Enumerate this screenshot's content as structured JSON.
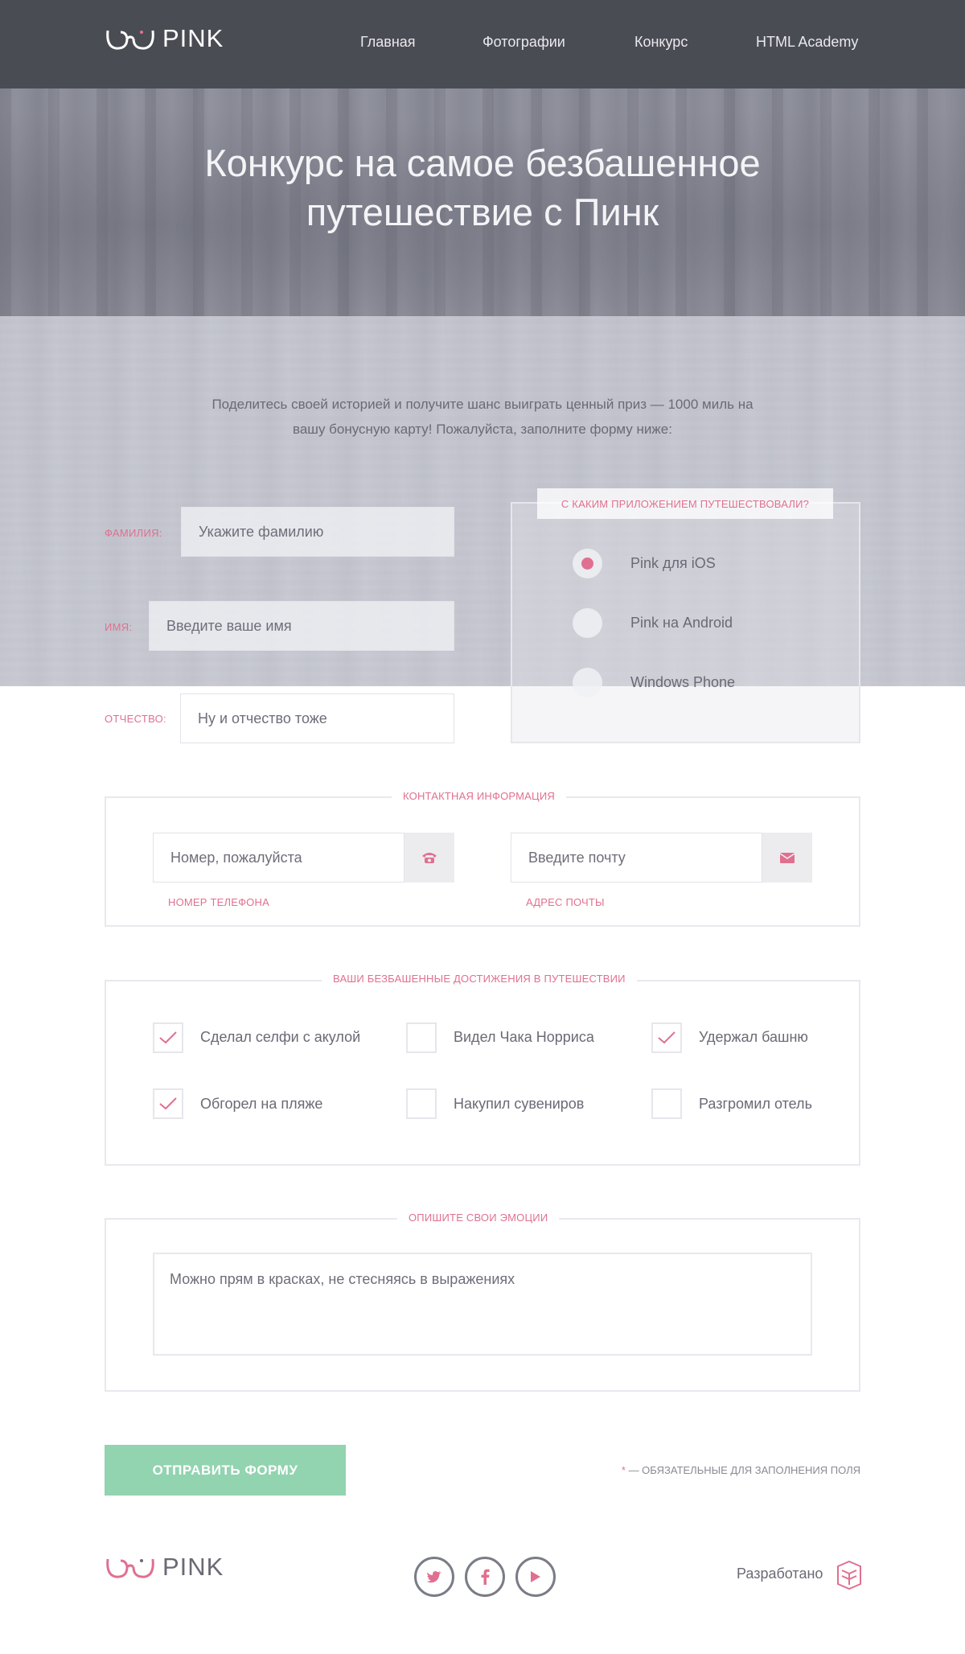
{
  "header": {
    "logo_text": "PINK",
    "nav": [
      "Главная",
      "Фотографии",
      "Конкурс",
      "HTML Academy"
    ]
  },
  "hero": {
    "title_line1": "Конкурс на самое безбашенное",
    "title_line2": "путешествие с Пинк"
  },
  "intro": {
    "line1": "Поделитесь своей историей и получите шанс выиграть ценный приз — 1000 миль на",
    "line2": "вашу бонусную карту! Пожалуйста, заполните форму ниже:"
  },
  "personal": {
    "surname_label": "ФАМИЛИЯ:",
    "surname_placeholder": "Укажите фамилию",
    "name_label": "ИМЯ:",
    "name_placeholder": "Введите ваше имя",
    "patronymic_label": "ОТЧЕСТВО:",
    "patronymic_placeholder": "Ну и отчество тоже"
  },
  "app_choice": {
    "legend": "С КАКИМ ПРИЛОЖЕНИЕМ ПУТЕШЕСТВОВАЛИ?",
    "options": [
      "Pink для iOS",
      "Pink на Android",
      "Windows Phone"
    ],
    "selected": "Pink для iOS"
  },
  "contacts": {
    "legend": "КОНТАКТНАЯ ИНФОРМАЦИЯ",
    "phone_placeholder": "Номер, пожалуйста",
    "phone_hint": "НОМЕР ТЕЛЕФОНА",
    "email_placeholder": "Введите почту",
    "email_hint": "АДРЕС ПОЧТЫ"
  },
  "achievements": {
    "legend": "ВАШИ БЕЗБАШЕННЫЕ ДОСТИЖЕНИЯ В ПУТЕШЕСТВИИ",
    "items": [
      {
        "label": "Сделал селфи с акулой",
        "checked": true
      },
      {
        "label": "Видел Чака Норриса",
        "checked": false
      },
      {
        "label": "Удержал башню",
        "checked": true
      },
      {
        "label": "Обгорел на пляже",
        "checked": true
      },
      {
        "label": "Накупил сувениров",
        "checked": false
      },
      {
        "label": "Разгромил отель",
        "checked": false
      }
    ]
  },
  "emotions": {
    "legend": "ОПИШИТЕ СВОИ ЭМОЦИИ",
    "placeholder": "Можно прям в красках, не стесняясь в выражениях"
  },
  "submit": {
    "label": "ОТПРАВИТЬ ФОРМУ",
    "required_star": "*",
    "required_note": " — ОБЯЗАТЕЛЬНЫЕ ДЛЯ ЗАПОЛНЕНИЯ ПОЛЯ"
  },
  "footer": {
    "logo_text": "PINK",
    "social": [
      "twitter-icon",
      "facebook-icon",
      "youtube-icon"
    ],
    "made_by": "Разработано"
  },
  "colors": {
    "accent": "#e07090",
    "submit": "#92d3b0",
    "header": "#4a4c53"
  }
}
